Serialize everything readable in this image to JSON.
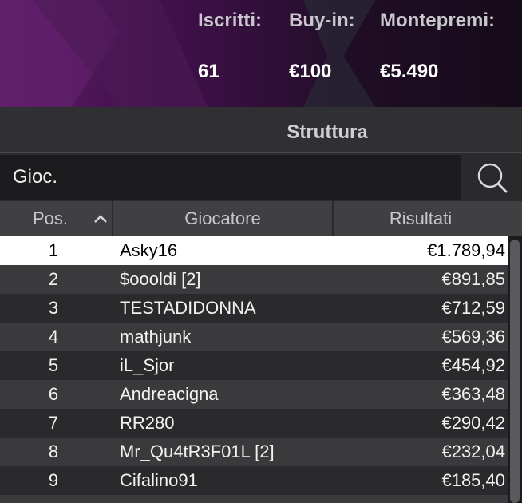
{
  "stats": [
    {
      "label": "Iscritti:",
      "value": "61"
    },
    {
      "label": "Buy-in:",
      "value": "€100"
    },
    {
      "label": "Montepremi:",
      "value": "€5.490"
    }
  ],
  "section": {
    "title": "Struttura"
  },
  "search": {
    "value": "Gioc.",
    "icon": "search-icon"
  },
  "table": {
    "headers": {
      "pos": "Pos.",
      "player": "Giocatore",
      "results": "Risultati"
    },
    "sort_icon": "chevron-up-icon",
    "rows": [
      {
        "pos": "1",
        "player": "Asky16",
        "result": "€1.789,94"
      },
      {
        "pos": "2",
        "player": "$ooo​ldi [2]",
        "result": "€891,85"
      },
      {
        "pos": "3",
        "player": "TESTADIDONNA",
        "result": "€712,59"
      },
      {
        "pos": "4",
        "player": "mathjunk",
        "result": "€569,36"
      },
      {
        "pos": "5",
        "player": "iL_Sjor",
        "result": "€454,92"
      },
      {
        "pos": "6",
        "player": "Andreacigna",
        "result": "€363,48"
      },
      {
        "pos": "7",
        "player": "RR280",
        "result": "€290,42"
      },
      {
        "pos": "8",
        "player": "Mr_Qu4tR3F01L [2]",
        "result": "€232,04"
      },
      {
        "pos": "9",
        "player": "Cifalino91",
        "result": "€185,40"
      }
    ]
  },
  "colors": {
    "selected_row": "#ffffff",
    "row_light": "#3a3a3c",
    "row_dark": "#2a2a2c",
    "banner_accent": "#5a1a63"
  }
}
